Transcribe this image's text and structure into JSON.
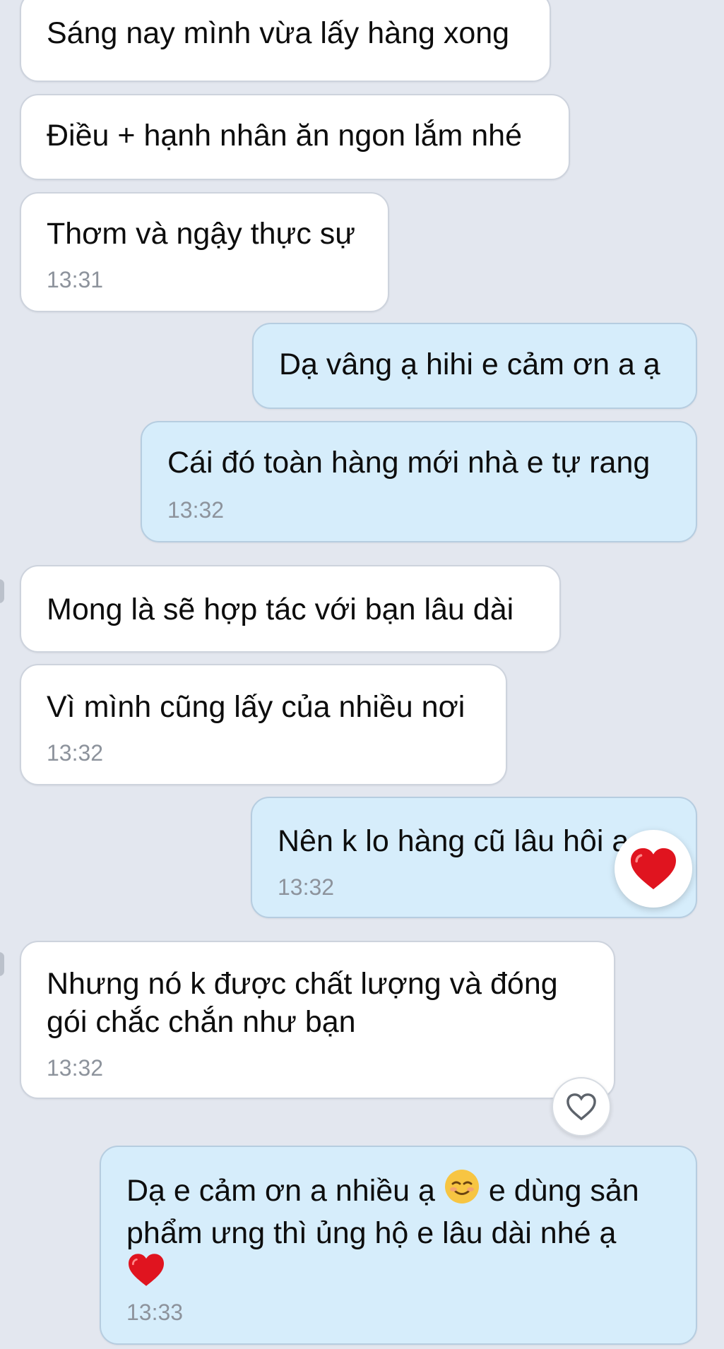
{
  "messages": [
    {
      "text": "Sáng nay mình vừa lấy hàng xong"
    },
    {
      "text": "Điều + hạnh nhân ăn ngon lắm nhé"
    },
    {
      "text": "Thơm và ngậy thực sự",
      "time": "13:31"
    },
    {
      "text": "Dạ vâng ạ hihi e cảm ơn a ạ"
    },
    {
      "text": "Cái đó toàn hàng mới nhà e tự rang",
      "time": "13:32"
    },
    {
      "text": "Mong là sẽ hợp tác với bạn lâu dài"
    },
    {
      "text": "Vì mình cũng lấy của nhiều nơi",
      "time": "13:32"
    },
    {
      "text": "Nên k lo hàng cũ lâu hôi ạ",
      "time": "13:32",
      "reaction": "heart-icon"
    },
    {
      "line1": "Nhưng nó k được chất lượng và đóng",
      "line2": "gói chắc chắn như bạn",
      "time": "13:32"
    },
    {
      "line1a": "Dạ e cảm ơn a nhiều ạ",
      "line1b": "e dùng sản",
      "line2": "phẩm ưng thì ủng hộ e lâu dài nhé ạ",
      "time": "13:33"
    }
  ],
  "colors": {
    "background": "#e3e7ef",
    "incoming_bubble": "#ffffff",
    "outgoing_bubble": "#d6edfb",
    "timestamp": "#8d939c",
    "heart": "#e0141f"
  }
}
